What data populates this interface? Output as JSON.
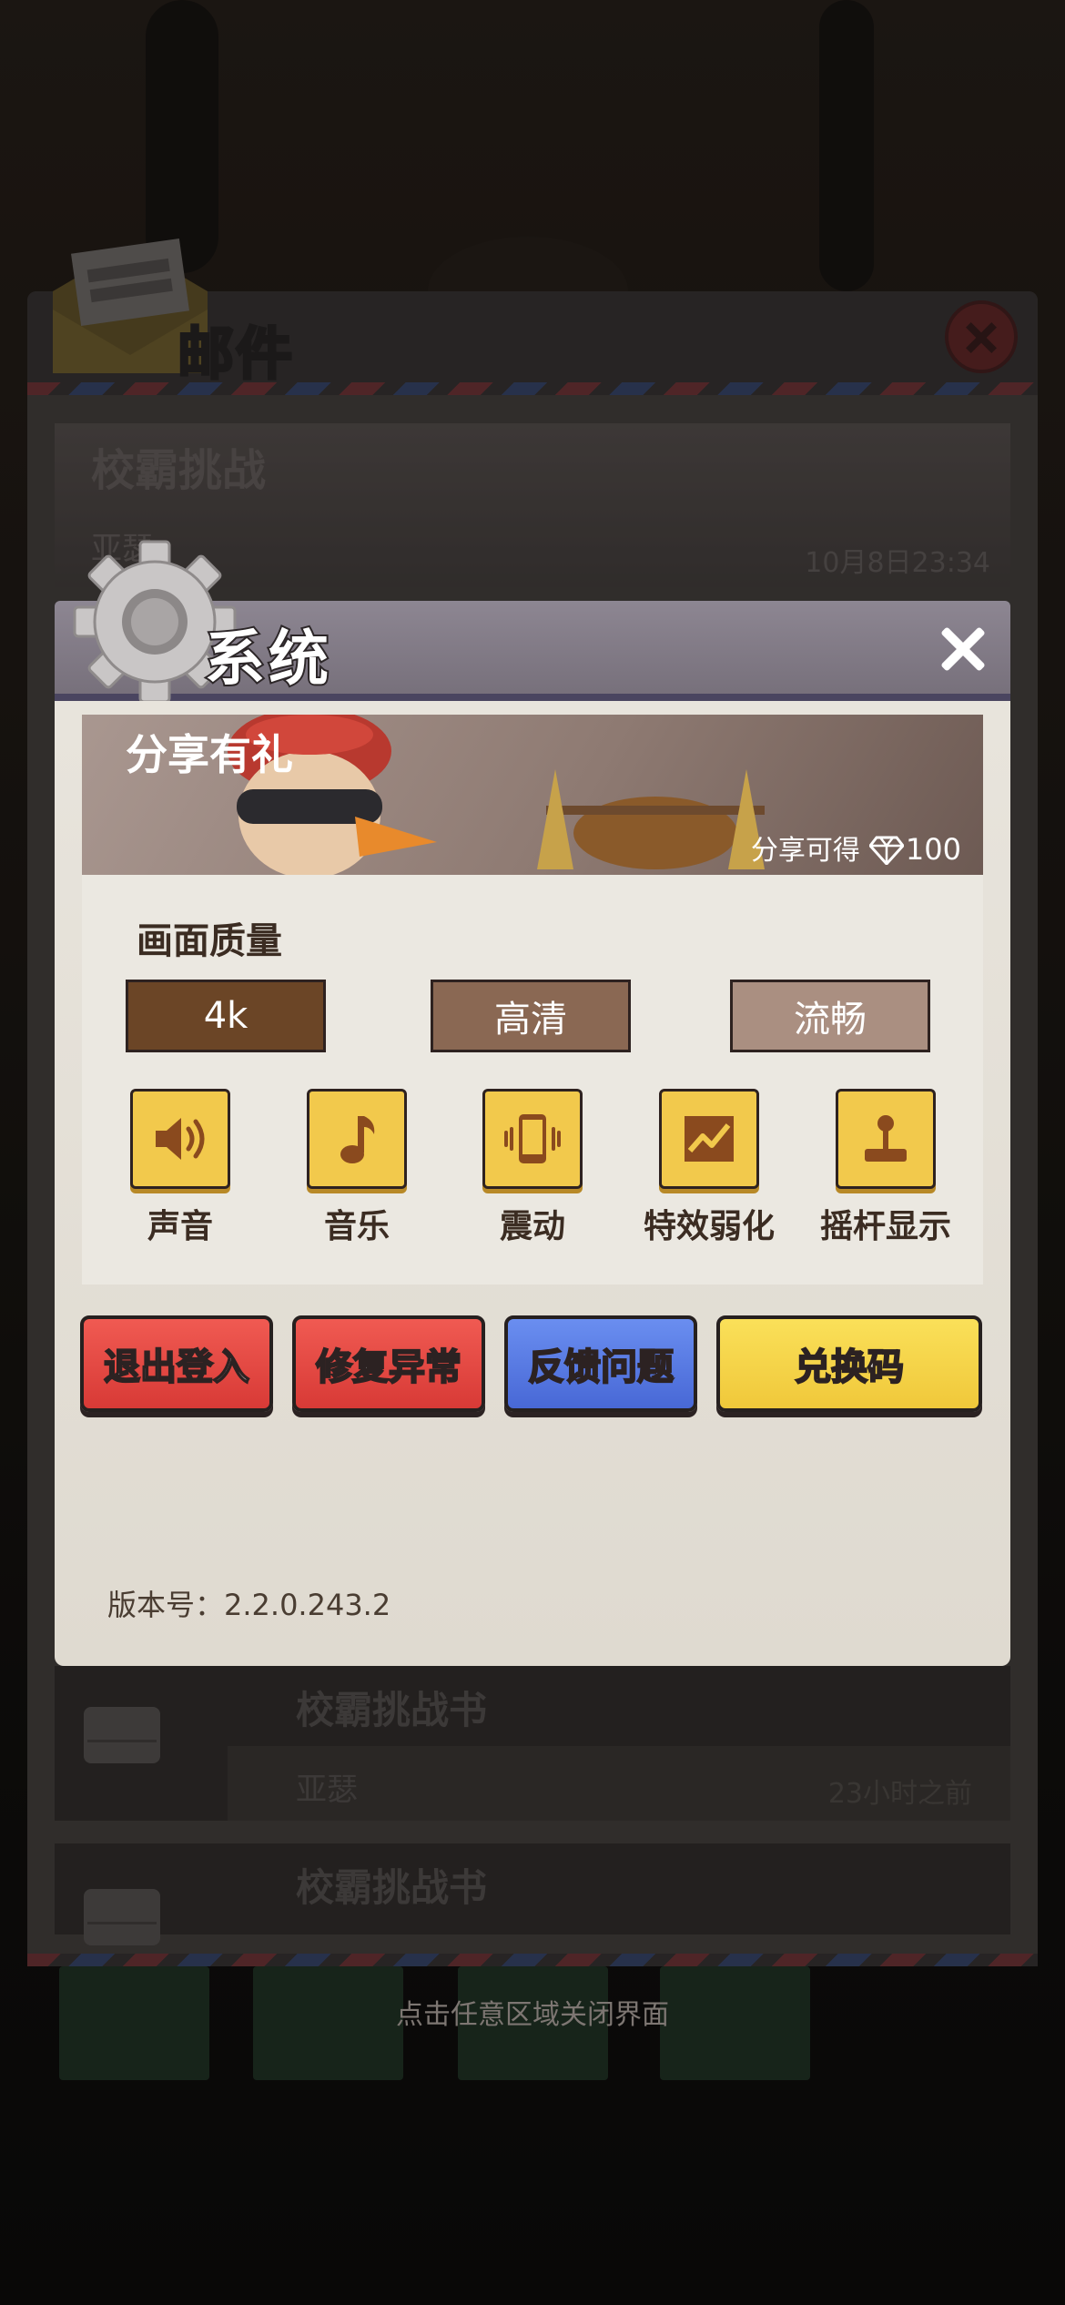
{
  "mail": {
    "title": "邮件",
    "banner": {
      "title": "校霸挑战",
      "sender": "亚瑟",
      "time": "10月8日23:34"
    },
    "items": [
      {
        "title": "校霸挑战书",
        "sender": "亚瑟",
        "time": "23小时之前"
      },
      {
        "title": "校霸挑战书"
      }
    ]
  },
  "system": {
    "title": "系统",
    "share": {
      "title": "分享有礼",
      "reward_text": "分享可得",
      "reward_amount": "100"
    },
    "quality": {
      "label": "画面质量",
      "options": [
        "4k",
        "高清",
        "流畅"
      ],
      "selected": "4k"
    },
    "toggles": [
      {
        "label": "声音",
        "icon": "speaker-icon"
      },
      {
        "label": "音乐",
        "icon": "music-note-icon"
      },
      {
        "label": "震动",
        "icon": "vibration-icon"
      },
      {
        "label": "特效弱化",
        "icon": "effects-chart-icon"
      },
      {
        "label": "摇杆显示",
        "icon": "joystick-icon"
      }
    ],
    "buttons": {
      "logout": "退出登入",
      "repair": "修复异常",
      "feedback": "反馈问题",
      "redeem": "兑换码"
    },
    "version": "版本号：2.2.0.243.2"
  },
  "hint": "点击任意区域关闭界面",
  "colors": {
    "accent_yellow": "#f2c94c",
    "button_red": "#e04840",
    "button_blue": "#5a7ce4",
    "quality_selected": "#6b4526"
  }
}
